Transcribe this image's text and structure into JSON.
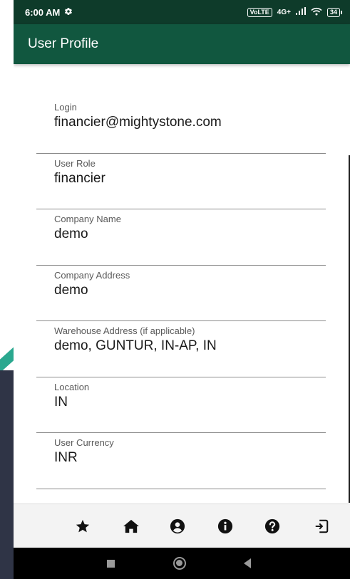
{
  "status_bar": {
    "time": "6:00 AM",
    "network": "4G+",
    "battery": "34"
  },
  "app_bar": {
    "title": "User Profile"
  },
  "profile": {
    "fields": [
      {
        "label": "Login",
        "value": "financier@mightystone.com"
      },
      {
        "label": "User Role",
        "value": "financier"
      },
      {
        "label": "Company Name",
        "value": "demo"
      },
      {
        "label": "Company Address",
        "value": "demo"
      },
      {
        "label": "Warehouse Address (if applicable)",
        "value": "demo, GUNTUR, IN-AP, IN"
      },
      {
        "label": "Location",
        "value": "IN"
      },
      {
        "label": "User Currency",
        "value": "INR"
      }
    ]
  },
  "bottom_nav": {
    "icons": [
      "star-icon",
      "home-icon",
      "account-icon",
      "info-icon",
      "help-icon",
      "logout-icon"
    ]
  },
  "colors": {
    "status_bar": "#0e3b2a",
    "app_bar": "#11573f",
    "divider": "#8c8c8c"
  }
}
